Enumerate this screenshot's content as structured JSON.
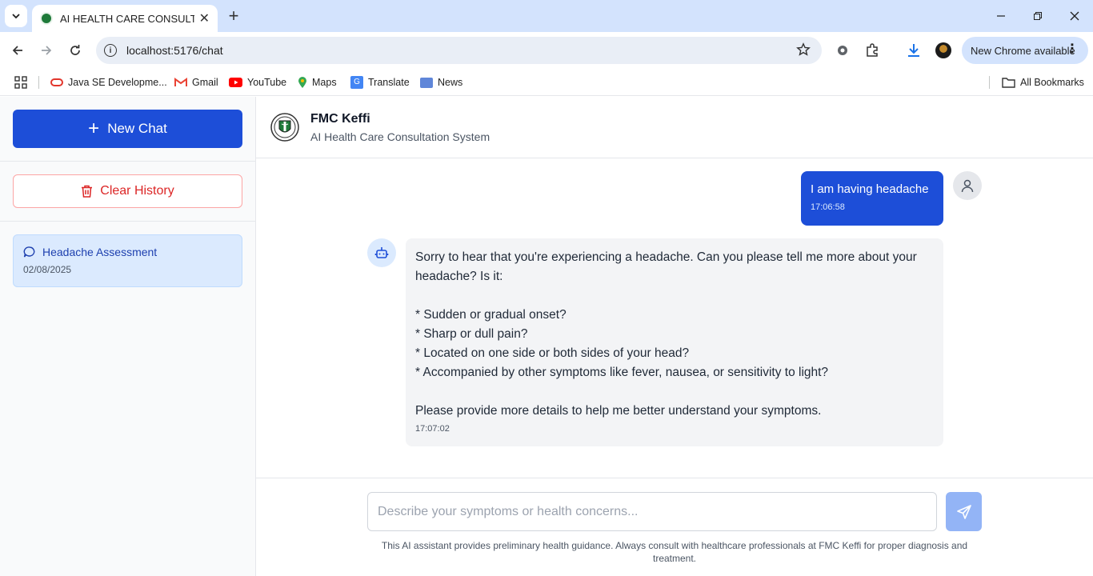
{
  "browser": {
    "tab_title": "AI HEALTH CARE CONSULTATIO",
    "url": "localhost:5176/chat",
    "chrome_update_label": "New Chrome available",
    "bookmarks": [
      {
        "label": "Java SE Developme..."
      },
      {
        "label": "Gmail"
      },
      {
        "label": "YouTube"
      },
      {
        "label": "Maps"
      },
      {
        "label": "Translate"
      },
      {
        "label": "News"
      }
    ],
    "all_bookmarks_label": "All Bookmarks"
  },
  "sidebar": {
    "new_chat_label": "New Chat",
    "clear_history_label": "Clear History",
    "history": [
      {
        "title": "Headache Assessment",
        "date": "02/08/2025"
      }
    ]
  },
  "header": {
    "title": "FMC Keffi",
    "subtitle": "AI Health Care Consultation System"
  },
  "messages": [
    {
      "role": "user",
      "text": "I am having headache",
      "time": "17:06:58"
    },
    {
      "role": "assistant",
      "text": "Sorry to hear that you're experiencing a headache. Can you please tell me more about your headache? Is it:\n\n* Sudden or gradual onset?\n* Sharp or dull pain?\n* Located on one side or both sides of your head?\n* Accompanied by other symptoms like fever, nausea, or sensitivity to light?\n\nPlease provide more details to help me better understand your symptoms.",
      "time": "17:07:02"
    }
  ],
  "composer": {
    "placeholder": "Describe your symptoms or health concerns...",
    "disclaimer": "This AI assistant provides preliminary health guidance. Always consult with healthcare professionals at FMC Keffi for proper diagnosis and treatment."
  },
  "colors": {
    "primary": "#1d4ed8",
    "danger": "#dc2626",
    "active_history_bg": "#dbeafe",
    "send_disabled": "#93b4f6"
  }
}
